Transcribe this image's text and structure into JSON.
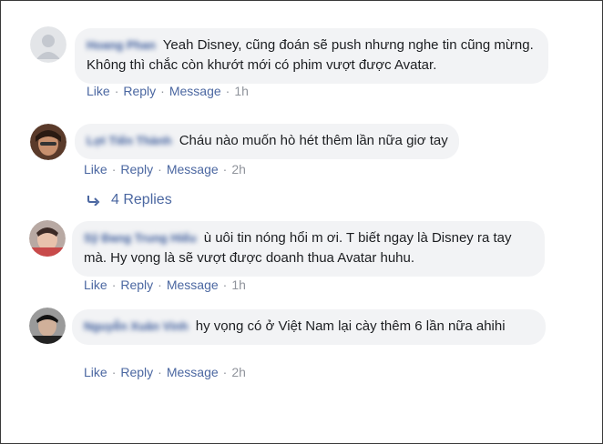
{
  "actions": {
    "like": "Like",
    "reply": "Reply",
    "message": "Message",
    "separator": "·"
  },
  "comments": [
    {
      "author": "Hoang Phan",
      "text": "Yeah Disney, cũng đoán sẽ push nhưng nghe tin cũng mừng. Không thì chắc còn khướt mới có phim vượt được Avatar.",
      "time": "1h"
    },
    {
      "author": "Lợi Tiến Thành",
      "text": "Cháu nào muốn hò hét thêm lần nữa giơ tay",
      "time": "2h"
    },
    {
      "author": "Sỹ Đang Trung Hiếu",
      "text": "ù uôi tin nóng hổi m ơi. T biết ngay là Disney ra tay mà. Hy vọng là sẽ vượt được doanh thua Avatar huhu.",
      "time": "1h"
    },
    {
      "author": "Nguyễn Xuân Vinh",
      "text": "hy vọng có ở Việt Nam lại cày thêm 6 lần nữa ahihi",
      "time": "2h"
    }
  ],
  "replies": {
    "label": "4 Replies",
    "icon": "reply-arrow-icon"
  }
}
